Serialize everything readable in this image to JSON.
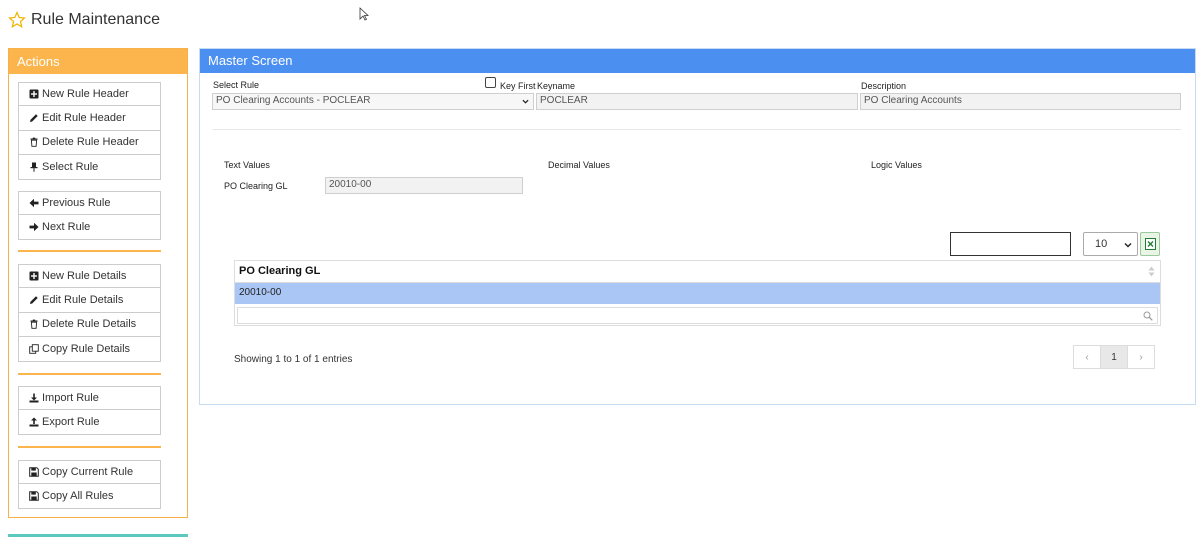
{
  "page": {
    "title": "Rule Maintenance"
  },
  "actions": {
    "title": "Actions",
    "groups": [
      {
        "buttons": [
          {
            "label": "New Rule Header",
            "icon": "plus-square-icon"
          },
          {
            "label": "Edit Rule Header",
            "icon": "pencil-icon"
          },
          {
            "label": "Delete Rule Header",
            "icon": "trash-icon"
          },
          {
            "label": "Select Rule",
            "icon": "pin-icon"
          }
        ]
      },
      {
        "buttons": [
          {
            "label": "Previous Rule",
            "icon": "arrow-left-icon"
          },
          {
            "label": "Next Rule",
            "icon": "arrow-right-icon"
          }
        ]
      },
      {
        "buttons": [
          {
            "label": "New Rule Details",
            "icon": "plus-square-icon"
          },
          {
            "label": "Edit Rule Details",
            "icon": "pencil-icon"
          },
          {
            "label": "Delete Rule Details",
            "icon": "trash-icon"
          },
          {
            "label": "Copy Rule Details",
            "icon": "copy-icon"
          }
        ]
      },
      {
        "buttons": [
          {
            "label": "Import Rule",
            "icon": "download-icon"
          },
          {
            "label": "Export Rule",
            "icon": "upload-icon"
          }
        ]
      },
      {
        "buttons": [
          {
            "label": "Copy Current Rule",
            "icon": "save-icon"
          },
          {
            "label": "Copy All Rules",
            "icon": "save-icon"
          }
        ]
      }
    ]
  },
  "master": {
    "title": "Master Screen",
    "select_rule_label": "Select Rule",
    "select_rule_value": "PO Clearing Accounts - POCLEAR",
    "key_first_label": "Key First",
    "keyname_label": "Keyname",
    "keyname_value": "POCLEAR",
    "description_label": "Description",
    "description_value": "PO Clearing Accounts",
    "text_values_label": "Text Values",
    "decimal_values_label": "Decimal Values",
    "logic_values_label": "Logic Values",
    "po_clearing_gl_label": "PO Clearing GL",
    "po_clearing_gl_value": "20010-00"
  },
  "table": {
    "page_size": "10",
    "column": "PO Clearing GL",
    "rows": [
      "20010-00"
    ],
    "info": "Showing 1 to 1 of 1 entries",
    "pager": {
      "prev": "‹",
      "current": "1",
      "next": "›"
    }
  },
  "colors": {
    "actions_accent": "#fbb54c",
    "master_accent": "#4b8ff0",
    "selected_row": "#a9c6f5"
  }
}
